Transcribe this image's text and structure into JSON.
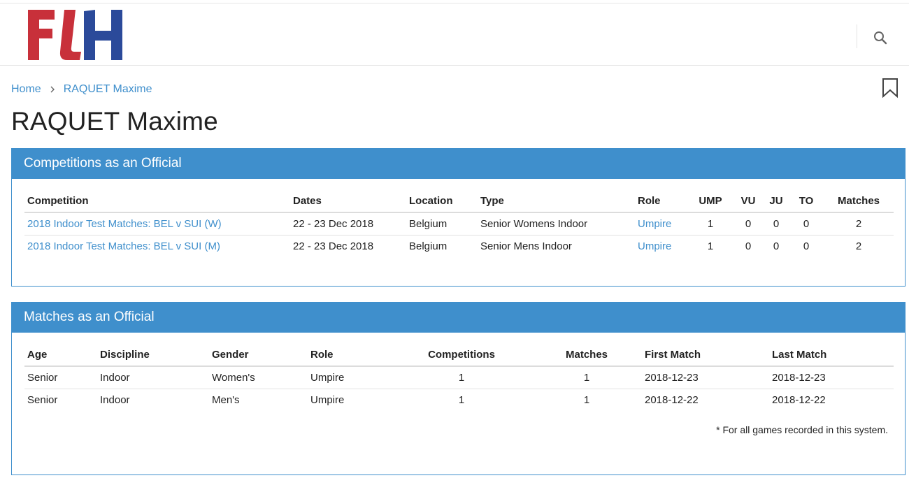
{
  "header": {
    "logo_text": "FIH"
  },
  "breadcrumb": {
    "home": "Home",
    "current": "RAQUET Maxime"
  },
  "page_title": "RAQUET Maxime",
  "competitions_panel": {
    "title": "Competitions as an Official",
    "columns": [
      "Competition",
      "Dates",
      "Location",
      "Type",
      "Role",
      "UMP",
      "VU",
      "JU",
      "TO",
      "Matches"
    ],
    "rows": [
      {
        "competition": "2018 Indoor Test Matches: BEL v SUI (W)",
        "dates": "22 - 23 Dec 2018",
        "location": "Belgium",
        "type": "Senior Womens Indoor",
        "role": "Umpire",
        "ump": "1",
        "vu": "0",
        "ju": "0",
        "to": "0",
        "matches": "2"
      },
      {
        "competition": "2018 Indoor Test Matches: BEL v SUI (M)",
        "dates": "22 - 23 Dec 2018",
        "location": "Belgium",
        "type": "Senior Mens Indoor",
        "role": "Umpire",
        "ump": "1",
        "vu": "0",
        "ju": "0",
        "to": "0",
        "matches": "2"
      }
    ]
  },
  "matches_panel": {
    "title": "Matches as an Official",
    "columns": [
      "Age",
      "Discipline",
      "Gender",
      "Role",
      "Competitions",
      "Matches",
      "First Match",
      "Last Match"
    ],
    "rows": [
      {
        "age": "Senior",
        "discipline": "Indoor",
        "gender": "Women's",
        "role": "Umpire",
        "competitions": "1",
        "matches": "1",
        "first_match": "2018-12-23",
        "last_match": "2018-12-23"
      },
      {
        "age": "Senior",
        "discipline": "Indoor",
        "gender": "Men's",
        "role": "Umpire",
        "competitions": "1",
        "matches": "1",
        "first_match": "2018-12-22",
        "last_match": "2018-12-22"
      }
    ],
    "footnote": "* For all games recorded in this system."
  },
  "colors": {
    "accent": "#3f8fcc",
    "logo_red": "#c8303a",
    "logo_blue": "#2b4a9a"
  },
  "icons": [
    "search-icon",
    "chevron-right-icon",
    "bookmark-icon"
  ]
}
